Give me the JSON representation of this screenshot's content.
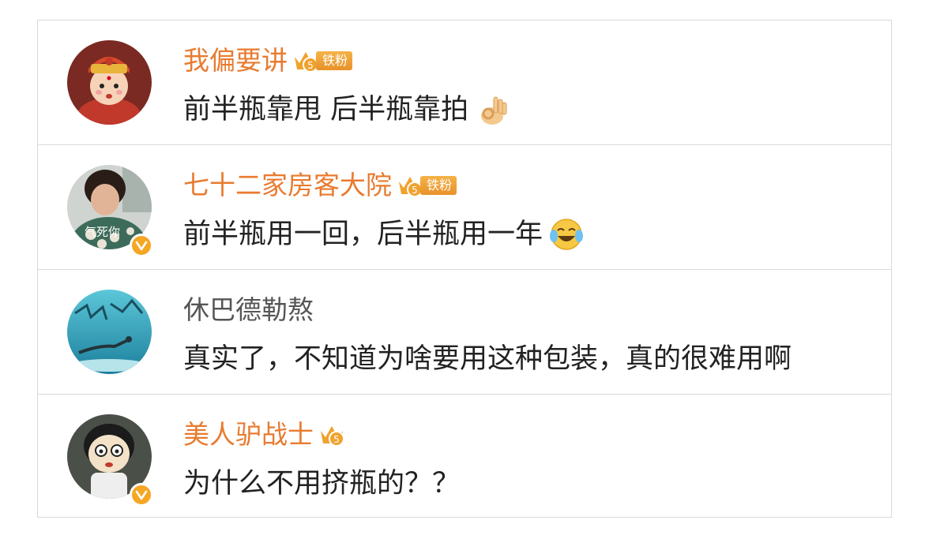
{
  "comments": [
    {
      "username": "我偏要讲",
      "badge_level": "5",
      "fan_tag": "铁粉",
      "text": "前半瓶靠甩 后半瓶靠拍",
      "emoji": "ok-hand-emoji",
      "avatar": "baby-doll-avatar",
      "verified": false
    },
    {
      "username": "七十二家房客大院",
      "badge_level": "5",
      "fan_tag": "铁粉",
      "text": "前半瓶用一回，后半瓶用一年",
      "emoji": "laugh-cry-emoji",
      "avatar": "woman-photo-avatar",
      "avatar_caption": "气死你",
      "verified": true
    },
    {
      "username": "休巴德勒熬",
      "text": "真实了，不知道为啥要用这种包装，真的很难用啊",
      "avatar": "underwater-swimmer-avatar",
      "verified": false
    },
    {
      "username": "美人驴战士",
      "badge_level": "5",
      "text": "为什么不用挤瓶的？？",
      "avatar": "cartoon-boy-avatar",
      "verified": true
    }
  ],
  "colors": {
    "username_vip": "#e87b2f",
    "username_plain": "#555555",
    "comment_text": "#222222",
    "badge_orange": "#f5a623",
    "divider": "#d9d9d9"
  }
}
